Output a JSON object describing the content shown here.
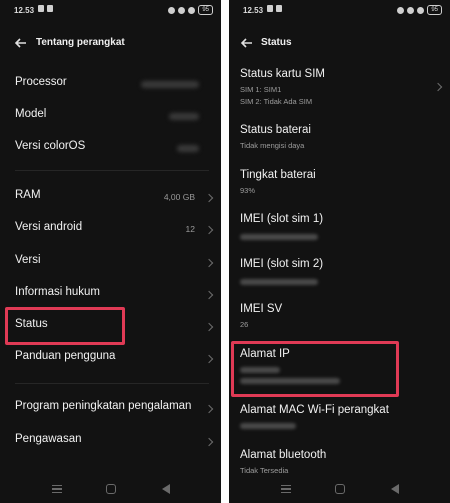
{
  "status_bar": {
    "time": "12.53",
    "battery": "95"
  },
  "left_screen": {
    "title": "Tentang perangkat",
    "rows": [
      {
        "label": "Processor",
        "value_hidden": true
      },
      {
        "label": "Model",
        "value_hidden": true
      },
      {
        "label": "Versi colorOS",
        "value_hidden": true
      },
      {
        "label": "RAM",
        "value": "4,00 GB"
      },
      {
        "label": "Versi android",
        "value": "12"
      },
      {
        "label": "Versi",
        "value": ""
      },
      {
        "label": "Informasi hukum",
        "value": ""
      },
      {
        "label": "Status",
        "value": ""
      },
      {
        "label": "Panduan pengguna",
        "value": ""
      },
      {
        "label": "Program peningkatan pengalaman",
        "value": ""
      },
      {
        "label": "Pengawasan",
        "value": ""
      }
    ]
  },
  "right_screen": {
    "title": "Status",
    "items": [
      {
        "title": "Status kartu SIM",
        "subs": [
          "SIM 1: SIM1",
          "SIM 2: Tidak Ada SIM"
        ]
      },
      {
        "title": "Status baterai",
        "subs": [
          "Tidak mengisi daya"
        ]
      },
      {
        "title": "Tingkat baterai",
        "subs": [
          "93%"
        ]
      },
      {
        "title": "IMEI (slot sim 1)",
        "subs": []
      },
      {
        "title": "IMEI (slot sim 2)",
        "subs": []
      },
      {
        "title": "IMEI SV",
        "subs": [
          "26"
        ]
      },
      {
        "title": "Alamat IP",
        "subs": []
      },
      {
        "title": "Alamat MAC Wi-Fi perangkat",
        "subs": []
      },
      {
        "title": "Alamat bluetooth",
        "subs": [
          "Tidak Tersedia"
        ]
      }
    ]
  },
  "colors": {
    "background": "#121212",
    "highlight": "#e03a55",
    "text": "#f2f2f2",
    "secondary": "#9d9d9d"
  },
  "icons": [
    "back-arrow-icon",
    "chevron-right-icon",
    "nav-menu-icon",
    "nav-home-icon",
    "nav-back-icon",
    "battery-icon",
    "wifi-icon"
  ]
}
